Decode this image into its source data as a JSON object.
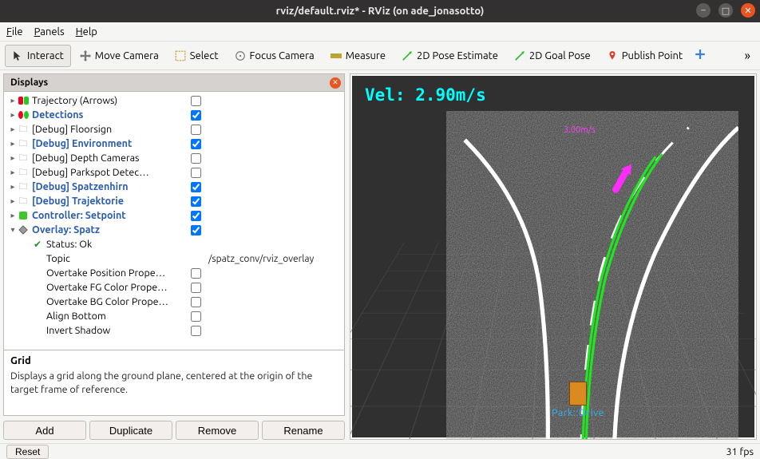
{
  "window": {
    "title": "rviz/default.rviz* - RViz (on ade_jonasotto)"
  },
  "menu": {
    "file": "File",
    "panels": "Panels",
    "help": "Help"
  },
  "toolbar": {
    "interact": "Interact",
    "move_camera": "Move Camera",
    "select": "Select",
    "focus_camera": "Focus Camera",
    "measure": "Measure",
    "pose_estimate": "2D Pose Estimate",
    "goal_pose": "2D Goal Pose",
    "publish_point": "Publish Point"
  },
  "panel": {
    "title": "Displays",
    "description_title": "Grid",
    "description_body": "Displays a grid along the ground plane, centered at the origin of the target frame of reference."
  },
  "tree": [
    {
      "label": "Trajectory (Arrows)",
      "kind": "item",
      "checked": false,
      "bold": false,
      "indent": 1,
      "icon": "arrows"
    },
    {
      "label": "Detections",
      "kind": "item",
      "checked": true,
      "bold": true,
      "indent": 1,
      "icon": "dots"
    },
    {
      "label": "[Debug] Floorsign",
      "kind": "folder",
      "checked": false,
      "bold": false,
      "indent": 1
    },
    {
      "label": "[Debug] Environment",
      "kind": "folder",
      "checked": true,
      "bold": true,
      "indent": 1
    },
    {
      "label": "[Debug] Depth Cameras",
      "kind": "folder",
      "checked": false,
      "bold": false,
      "indent": 1
    },
    {
      "label": "[Debug] Parkspot Detec…",
      "kind": "folder",
      "checked": false,
      "bold": false,
      "indent": 1
    },
    {
      "label": "[Debug] Spatzenhirn",
      "kind": "folder",
      "checked": true,
      "bold": true,
      "indent": 1
    },
    {
      "label": "[Debug] Trajektorie",
      "kind": "folder",
      "checked": true,
      "bold": true,
      "indent": 1
    },
    {
      "label": "Controller: Setpoint",
      "kind": "item",
      "checked": true,
      "bold": true,
      "indent": 1,
      "icon": "green"
    },
    {
      "label": "Overlay: Spatz",
      "kind": "item",
      "checked": true,
      "bold": true,
      "indent": 1,
      "icon": "diamond",
      "expanded": true
    },
    {
      "label": "Status: Ok",
      "kind": "status",
      "indent": 2,
      "icon": "check"
    },
    {
      "label": "Topic",
      "kind": "prop",
      "indent": 2,
      "value": "/spatz_conv/rviz_overlay"
    },
    {
      "label": "Overtake Position Prope…",
      "kind": "prop",
      "indent": 2,
      "value": "",
      "checkbox": true
    },
    {
      "label": "Overtake FG Color Prope…",
      "kind": "prop",
      "indent": 2,
      "value": "",
      "checkbox": true
    },
    {
      "label": "Overtake BG Color Prope…",
      "kind": "prop",
      "indent": 2,
      "value": "",
      "checkbox": true
    },
    {
      "label": "Align Bottom",
      "kind": "prop",
      "indent": 2,
      "value": "",
      "checkbox": true
    },
    {
      "label": "Invert Shadow",
      "kind": "prop",
      "indent": 2,
      "value": "",
      "checkbox": true
    }
  ],
  "buttons": {
    "add": "Add",
    "duplicate": "Duplicate",
    "remove": "Remove",
    "rename": "Rename",
    "reset": "Reset"
  },
  "scene": {
    "velocity_overlay": "Vel: 2.90m/s",
    "speed_marker": "3.00m/s",
    "mode_label": "Park::Drive"
  },
  "status": {
    "fps": "31 fps"
  }
}
